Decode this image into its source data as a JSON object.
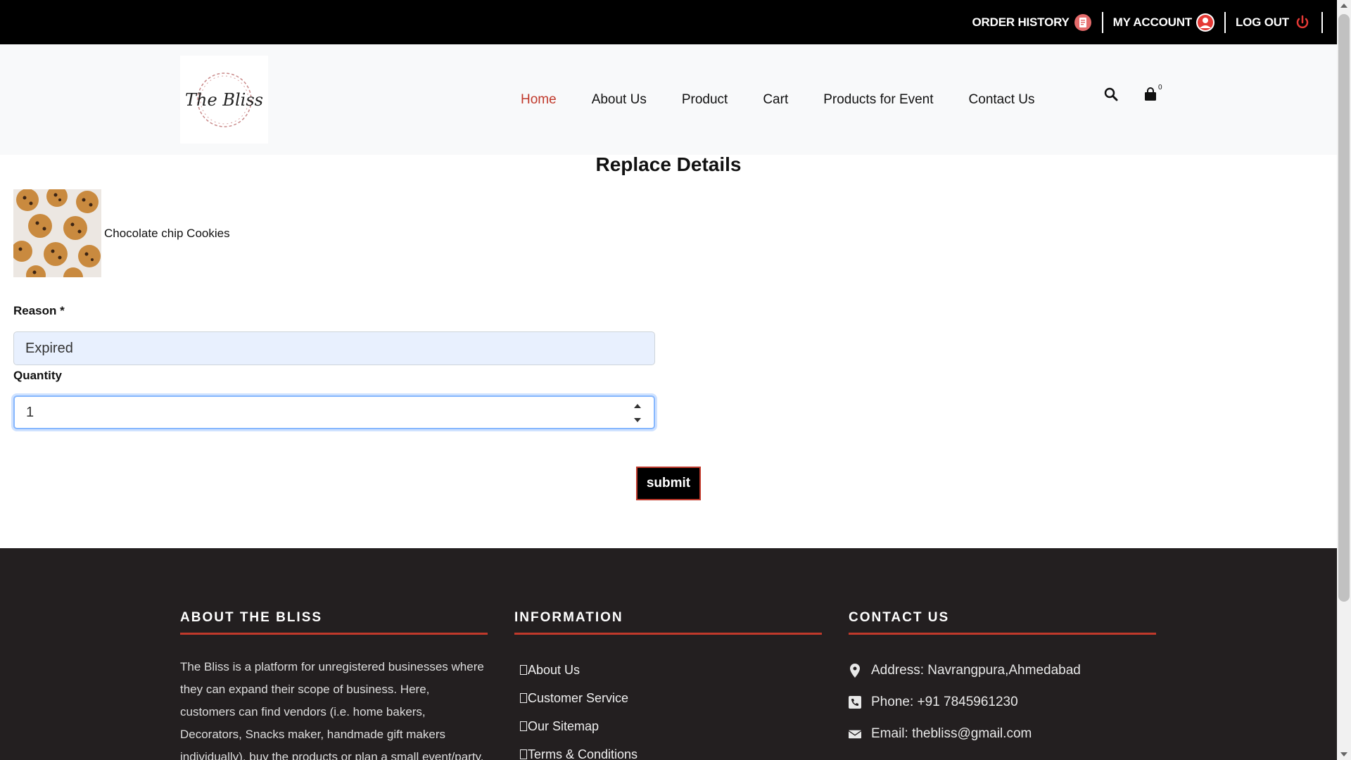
{
  "topbar": {
    "order_history": "ORDER HISTORY",
    "my_account": "MY ACCOUNT",
    "log_out": "LOG OUT"
  },
  "header": {
    "logo_text": "The Bliss",
    "nav": [
      "Home",
      "About Us",
      "Product",
      "Cart",
      "Products for Event",
      "Contact Us"
    ],
    "active_nav": "Home",
    "cart_count": "0"
  },
  "main": {
    "title": "Replace Details",
    "product_name": "Chocolate chip Cookies",
    "reason_label": "Reason *",
    "reason_value": "Expired",
    "quantity_label": "Quantity",
    "quantity_value": "1",
    "submit_label": "submit"
  },
  "footer": {
    "about_title": "ABOUT THE BLISS",
    "about_text": "The Bliss is a platform for unregistered businesses where they can expand their scope of business. Here, customers can find vendors (i.e. home bakers, Decorators, Snacks maker, handmade gift makers individually), buy the products or plan a small event/party.",
    "info_title": "INFORMATION",
    "info_links": [
      "About Us",
      "Customer Service",
      "Our Sitemap",
      "Terms & Conditions"
    ],
    "contact_title": "CONTACT US",
    "contact_address": "Address: Navrangpura,Ahmedabad",
    "contact_phone": "Phone: +91 7845961230",
    "contact_email": "Email: thebliss@gmail.com"
  },
  "colors": {
    "accent": "#c0392b",
    "topbar_bg": "#000000",
    "footer_bg": "#231f20"
  }
}
